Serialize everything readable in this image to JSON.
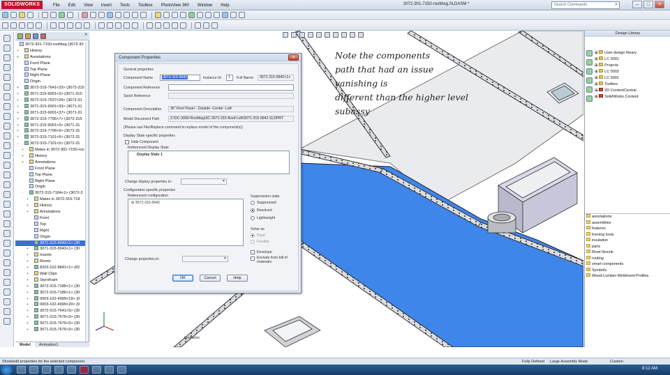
{
  "app": {
    "brand": "SOLIDWORKS",
    "document_title": "3072-301-7150-roofdwg.SLDASM *",
    "menu": [
      "File",
      "Edit",
      "View",
      "Insert",
      "Tools",
      "Toolbox",
      "PhotoView 360",
      "Window",
      "Help"
    ],
    "search_placeholder": "Search Commands"
  },
  "feature_tree": {
    "rows": [
      {
        "label": "3072-301-7150-roofdwg (3072-30",
        "level": 0,
        "icon": "assembly",
        "toggle": "",
        "selected": false
      },
      {
        "label": "History",
        "level": 1,
        "icon": "folder",
        "toggle": "+",
        "selected": false
      },
      {
        "label": "Annotations",
        "level": 1,
        "icon": "folder",
        "toggle": "+",
        "selected": false
      },
      {
        "label": "Front Plane",
        "level": 1,
        "icon": "plane",
        "toggle": "",
        "selected": false
      },
      {
        "label": "Top Plane",
        "level": 1,
        "icon": "plane",
        "toggle": "",
        "selected": false
      },
      {
        "label": "Right Plane",
        "level": 1,
        "icon": "plane",
        "toggle": "",
        "selected": false
      },
      {
        "label": "Origin",
        "level": 1,
        "icon": "plane",
        "toggle": "",
        "selected": false
      },
      {
        "label": "3072-315-7641<33> (3072-315",
        "level": 1,
        "icon": "part",
        "toggle": "+",
        "selected": false
      },
      {
        "label": "3071-315-9001<3> (3071-315",
        "level": 1,
        "icon": "part",
        "toggle": "+",
        "selected": false
      },
      {
        "label": "3072-315-7637<29> (3072-31",
        "level": 1,
        "icon": "part",
        "toggle": "+",
        "selected": false
      },
      {
        "label": "3071-315-9001<33> (3071-31",
        "level": 1,
        "icon": "part",
        "toggle": "+",
        "selected": false
      },
      {
        "label": "3071-315-9001<37> (3071-31",
        "level": 1,
        "icon": "part",
        "toggle": "+",
        "selected": false
      },
      {
        "label": "3072-315-7706<7> (3072-315",
        "level": 1,
        "icon": "part",
        "toggle": "+",
        "selected": false
      },
      {
        "label": "3071-315-9001<3> (3071-31",
        "level": 1,
        "icon": "part",
        "toggle": "+",
        "selected": false
      },
      {
        "label": "3072-315-7706<9> (3072-31",
        "level": 1,
        "icon": "part",
        "toggle": "+",
        "selected": false
      },
      {
        "label": "3072-315-7101<5> (3072-31",
        "level": 1,
        "icon": "part",
        "toggle": "+",
        "selected": false
      },
      {
        "label": "3072-315-7101<5> (3072-31",
        "level": 1,
        "icon": "part",
        "toggle": "-",
        "selected": false
      },
      {
        "label": "Mates in 3072-301-7150-roo",
        "level": 2,
        "icon": "folder",
        "toggle": "+",
        "selected": false
      },
      {
        "label": "History",
        "level": 2,
        "icon": "folder",
        "toggle": "+",
        "selected": false
      },
      {
        "label": "Annotations",
        "level": 2,
        "icon": "folder",
        "toggle": "+",
        "selected": false
      },
      {
        "label": "Front Plane",
        "level": 2,
        "icon": "plane",
        "toggle": "",
        "selected": false
      },
      {
        "label": "Top Plane",
        "level": 2,
        "icon": "plane",
        "toggle": "",
        "selected": false
      },
      {
        "label": "Right Plane",
        "level": 2,
        "icon": "plane",
        "toggle": "",
        "selected": false
      },
      {
        "label": "Origin",
        "level": 2,
        "icon": "plane",
        "toggle": "",
        "selected": false
      },
      {
        "label": "3072-315-7184<1> (3072-3",
        "level": 2,
        "icon": "part",
        "toggle": "-",
        "selected": false
      },
      {
        "label": "Mates in 3072-315-718",
        "level": 3,
        "icon": "folder",
        "toggle": "+",
        "selected": false
      },
      {
        "label": "History",
        "level": 3,
        "icon": "folder",
        "toggle": "+",
        "selected": false
      },
      {
        "label": "Annotations",
        "level": 3,
        "icon": "folder",
        "toggle": "+",
        "selected": false
      },
      {
        "label": "Front",
        "level": 3,
        "icon": "plane",
        "toggle": "",
        "selected": false
      },
      {
        "label": "Top",
        "level": 3,
        "icon": "plane",
        "toggle": "",
        "selected": false
      },
      {
        "label": "Right",
        "level": 3,
        "icon": "plane",
        "toggle": "",
        "selected": false
      },
      {
        "label": "Origin",
        "level": 3,
        "icon": "plane",
        "toggle": "",
        "selected": false
      },
      {
        "label": "3071-315-9942<1> (30",
        "level": 3,
        "icon": "part",
        "toggle": "+",
        "selected": true
      },
      {
        "label": "3071-315-9943<1> (30",
        "level": 3,
        "icon": "part",
        "toggle": "+",
        "selected": false
      },
      {
        "label": "Inserts",
        "level": 3,
        "icon": "folder",
        "toggle": "+",
        "selected": false
      },
      {
        "label": "Rivets",
        "level": 3,
        "icon": "folder",
        "toggle": "+",
        "selected": false
      },
      {
        "label": "8203-102-8841<1> (82",
        "level": 3,
        "icon": "part",
        "toggle": "+",
        "selected": false
      },
      {
        "label": "Wall Clips",
        "level": 3,
        "icon": "folder",
        "toggle": "+",
        "selected": false
      },
      {
        "label": "Styrofoam",
        "level": 3,
        "icon": "folder",
        "toggle": "+",
        "selected": false
      },
      {
        "label": "3072-315-7185<1> (30",
        "level": 3,
        "icon": "part",
        "toggle": "+",
        "selected": false
      },
      {
        "label": "3072-315-7186<1> (30",
        "level": 3,
        "icon": "part",
        "toggle": "+",
        "selected": false
      },
      {
        "label": "0003-102-4999<19> (0",
        "level": 3,
        "icon": "part",
        "toggle": "+",
        "selected": false
      },
      {
        "label": "0003-102-4999<20> (0",
        "level": 3,
        "icon": "part",
        "toggle": "+",
        "selected": false
      },
      {
        "label": "3072-315-7641<5> (30",
        "level": 3,
        "icon": "part",
        "toggle": "+",
        "selected": false
      },
      {
        "label": "3071-315-7676<3> (30",
        "level": 3,
        "icon": "part",
        "toggle": "+",
        "selected": false
      },
      {
        "label": "3071-315-7676<3> (30",
        "level": 3,
        "icon": "part",
        "toggle": "+",
        "selected": false
      },
      {
        "label": "3071-315-7676<3> (30",
        "level": 3,
        "icon": "part",
        "toggle": "+",
        "selected": false
      }
    ],
    "bottom_tabs": [
      "Model",
      "Animation1"
    ]
  },
  "viewport": {
    "annotation_lines": [
      "Note the components",
      "path that had an issue",
      "vanishing is",
      "different than the higher level",
      "subassy"
    ],
    "view_label": "Isometric"
  },
  "dialog": {
    "title": "Component Properties",
    "general_group": "General properties",
    "component_name_label": "Component Name",
    "component_name_value": "3071-315-9942",
    "instance_id_label": "Instance Id:",
    "instance_id_value": "1",
    "full_name_label": "Full Name:",
    "full_name_value": "3071-315-9942<1>",
    "component_reference_label": "Component Reference",
    "spool_reference_label": "Spool Reference",
    "component_description_label": "Component Description",
    "component_description_value": "36\" Roof Panel - Outside -Center -Left",
    "model_document_path_label": "Model Document Path",
    "model_document_path_value": "Z:\\DC-3000-Roofdwg\\3C-3071-315-Roof-Left\\3071-315-9942.SLDPRT",
    "replace_note": "(Please use File/Replace command to replace model of the component(s))",
    "display_state_group": "Display State specific properties",
    "hide_component_label": "Hide Component",
    "referenced_display_state_label": "Referenced Display State",
    "display_states": [
      "Display State 1"
    ],
    "change_display_label": "Change display properties in:",
    "config_group": "Configuration specific properties",
    "referenced_config_label": "Referenced configuration",
    "configurations": [
      "3071-315-9942"
    ],
    "suppression_label": "Suppression state",
    "suppression_options": [
      {
        "label": "Suppressed",
        "checked": false
      },
      {
        "label": "Resolved",
        "checked": true
      },
      {
        "label": "Lightweight",
        "checked": false
      }
    ],
    "solve_as_label": "Solve as",
    "solve_as_options": [
      {
        "label": "Rigid",
        "checked": true
      },
      {
        "label": "Flexible",
        "checked": false
      }
    ],
    "envelope_label": "Envelope",
    "exclude_bom_label": "Exclude from bill of materials",
    "change_properties_label": "Change properties in:",
    "ok_label": "OK",
    "cancel_label": "Cancel",
    "help_label": "Help"
  },
  "design_library": {
    "title": "Design Library",
    "tree": [
      {
        "label": "User design library",
        "icon": "folder"
      },
      {
        "label": "LC 5001",
        "icon": "folder"
      },
      {
        "label": "Projects",
        "icon": "folder"
      },
      {
        "label": "LC 5002",
        "icon": "folder"
      },
      {
        "label": "LC 5001",
        "icon": "folder"
      },
      {
        "label": "Toolbox",
        "icon": "folder"
      },
      {
        "label": "3D ContentCentral",
        "icon": "web"
      },
      {
        "label": "SolidWorks Content",
        "icon": "web"
      }
    ],
    "items": [
      "annotations",
      "assemblies",
      "features",
      "forming tools",
      "insulation",
      "parts",
      "Rivet Nozzle",
      "routing",
      "smart components",
      "Symbols",
      "Wood-Lumber-Weldment-Profiles"
    ]
  },
  "status_bar": {
    "message": "Show/edit properties for the selected component.",
    "definition": "Fully Defined",
    "mode": "Large Assembly Mode",
    "units": "Custom"
  },
  "taskbar": {
    "clock": "8:12 AM"
  },
  "colors": {
    "floor_blue": "#3e86ea",
    "selection_blue": "#3b6fd6",
    "brand_red": "#c8102e"
  }
}
